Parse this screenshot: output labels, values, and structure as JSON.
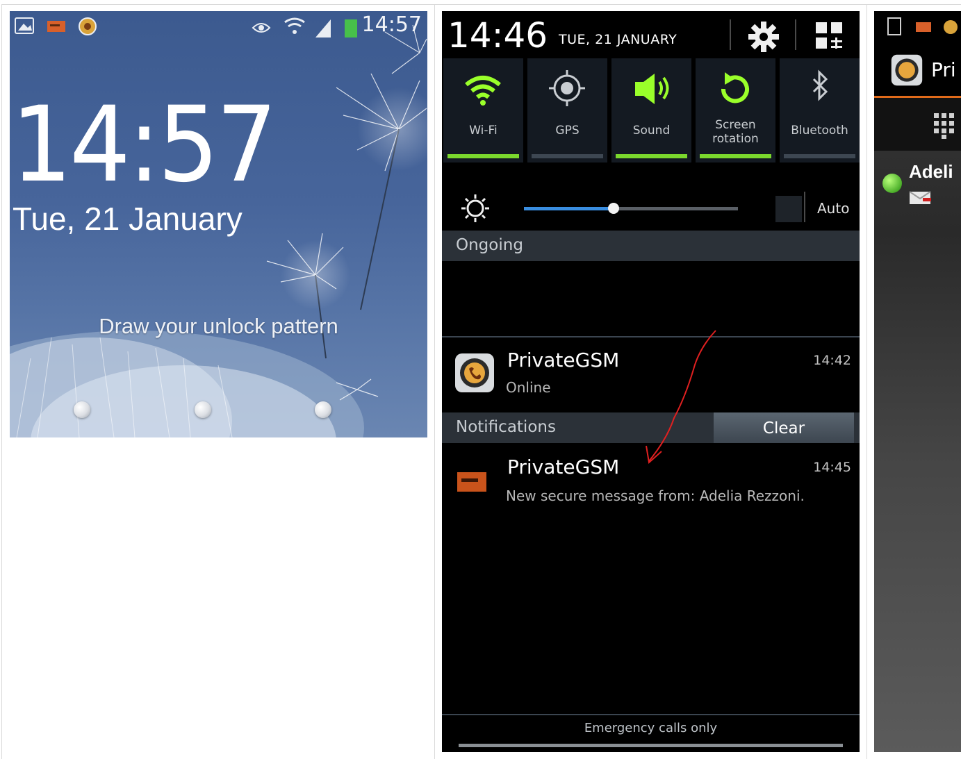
{
  "lock_screen": {
    "status_time": "14:57",
    "time": "14:57",
    "date": "Tue, 21 January",
    "prompt": "Draw your unlock pattern"
  },
  "notification_panel": {
    "time": "14:46",
    "date": "TUE, 21 JANUARY",
    "quick_toggles": [
      {
        "label": "Wi-Fi",
        "icon": "wifi-icon",
        "on": true
      },
      {
        "label": "GPS",
        "icon": "gps-icon",
        "on": false
      },
      {
        "label": "Sound",
        "icon": "sound-icon",
        "on": true
      },
      {
        "label": "Screen rotation",
        "icon": "rotation-icon",
        "on": true
      },
      {
        "label": "Bluetooth",
        "icon": "bluetooth-icon",
        "on": false
      }
    ],
    "brightness": {
      "level": 0.42,
      "auto_label": "Auto"
    },
    "ongoing": {
      "header": "Ongoing",
      "items": [
        {
          "title": "PrivateGSM",
          "subtitle": "Online",
          "time": "14:42"
        }
      ]
    },
    "notifications": {
      "header": "Notifications",
      "clear_label": "Clear",
      "items": [
        {
          "title": "PrivateGSM",
          "subtitle": "New secure message from: Adelia Rezzoni.",
          "time": "14:45"
        }
      ]
    },
    "footer": "Emergency calls only"
  },
  "app_screen": {
    "title": "Pri",
    "contact": "Adeli"
  },
  "colors": {
    "toggle_on": "#7bd82d",
    "accent_orange": "#e06a1a",
    "slider_blue": "#3a8ee0",
    "annotation_red": "#e02020"
  }
}
